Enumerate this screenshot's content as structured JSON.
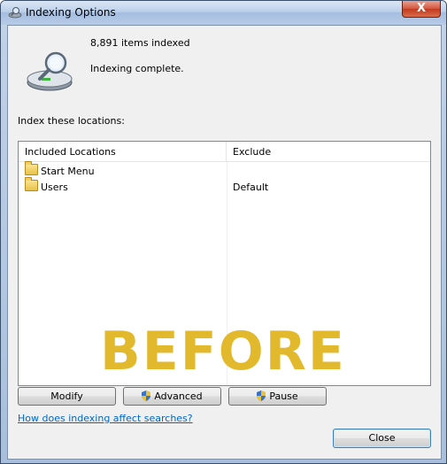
{
  "window": {
    "title": "Indexing Options",
    "close_glyph": "X"
  },
  "status": {
    "items_indexed": "8,891 items indexed",
    "state": "Indexing complete."
  },
  "locations": {
    "label": "Index these locations:",
    "columns": [
      "Included Locations",
      "Exclude"
    ],
    "rows": [
      {
        "location": "Start Menu",
        "exclude": ""
      },
      {
        "location": "Users",
        "exclude": "Default"
      }
    ]
  },
  "watermark": "BEFORE",
  "buttons": {
    "modify": "Modify",
    "advanced": "Advanced",
    "pause": "Pause",
    "close": "Close"
  },
  "help_link": "How does indexing affect searches?",
  "icons": {
    "title": "indexing-options-icon",
    "drive": "indexing-drive-icon",
    "folder": "folder-icon",
    "shield": "uac-shield-icon"
  },
  "colors": {
    "watermark": "#e2b92d",
    "link": "#0066cc"
  }
}
